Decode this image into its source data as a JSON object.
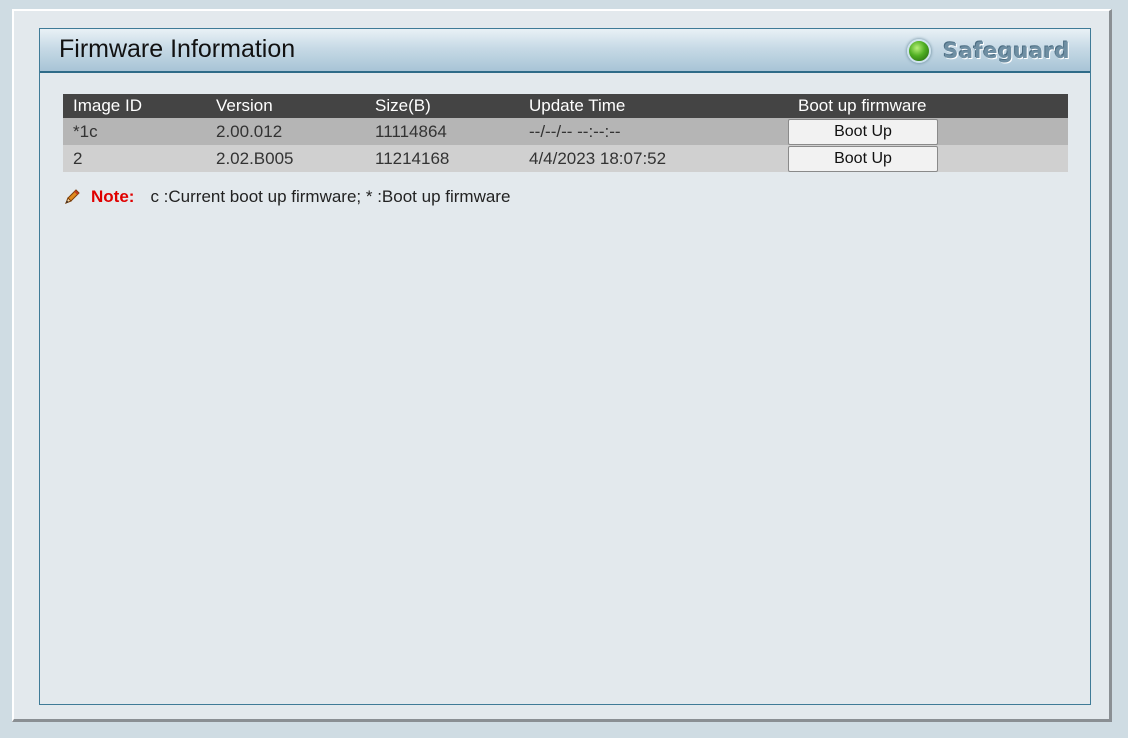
{
  "header": {
    "title": "Firmware Information",
    "safeguard_label": "Safeguard"
  },
  "table": {
    "columns": [
      "Image ID",
      "Version",
      "Size(B)",
      "Update Time",
      "Boot up firmware"
    ],
    "rows": [
      {
        "image_id": "*1c",
        "version": "2.00.012",
        "size": "11114864",
        "update_time": "--/--/-- --:--:--",
        "action": "Boot Up"
      },
      {
        "image_id": "2",
        "version": "2.02.B005",
        "size": "11214168",
        "update_time": "4/4/2023 18:07:52",
        "action": "Boot Up"
      }
    ]
  },
  "note": {
    "label": "Note:",
    "text": "c :Current boot up firmware; * :Boot up firmware"
  },
  "colors": {
    "header_border": "#2f6b88",
    "table_header_bg": "#444444",
    "note_label": "#e00000",
    "safeguard_led": "#4fae22"
  },
  "icons": {
    "note": "pencil-icon",
    "safeguard": "green-led-icon"
  }
}
